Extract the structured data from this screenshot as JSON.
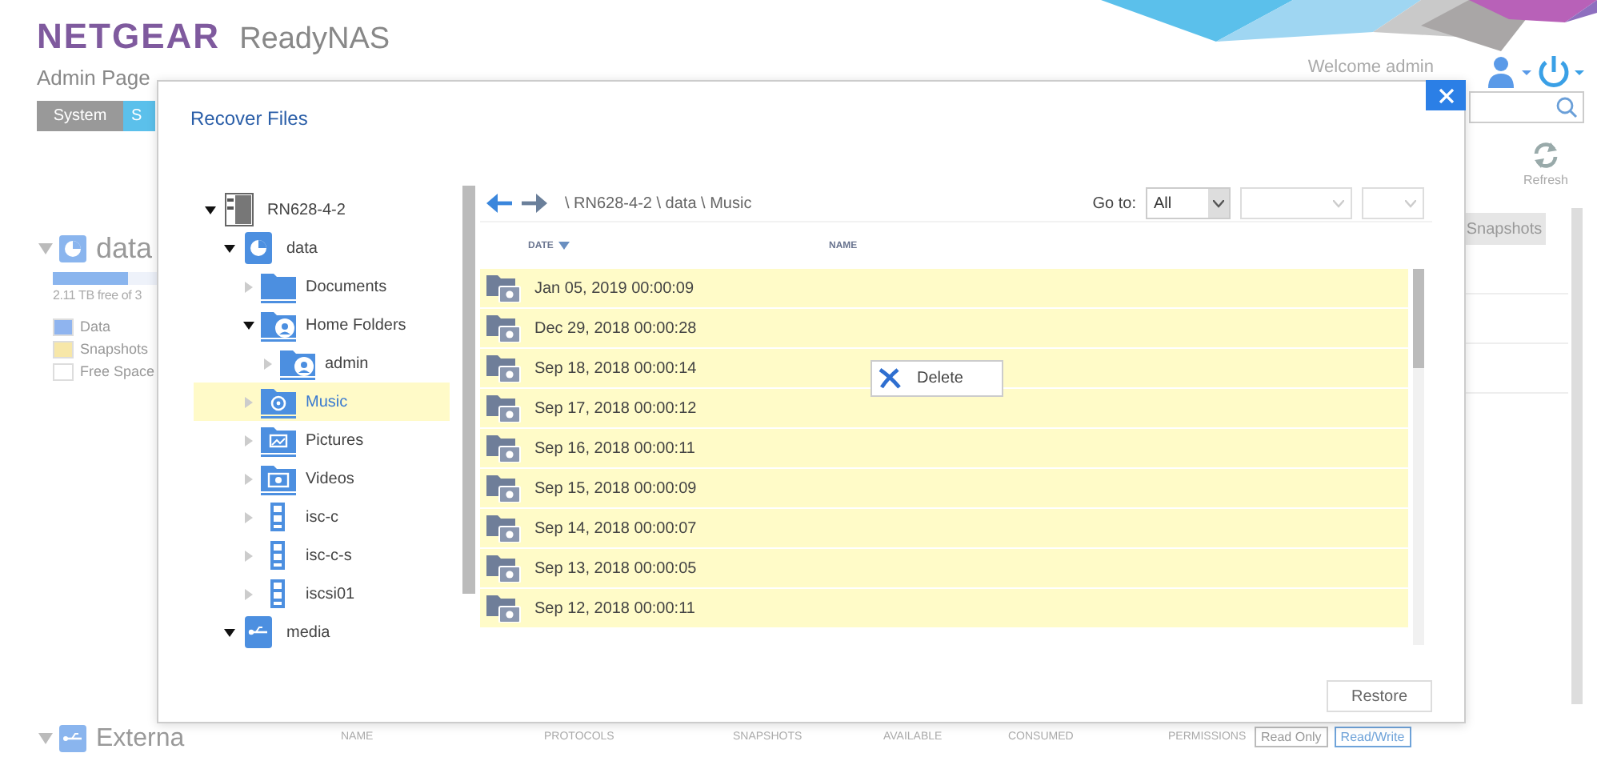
{
  "header": {
    "brand": "NETGEAR",
    "product": "ReadyNAS",
    "subtitle": "Admin Page",
    "welcome": "Welcome admin"
  },
  "nav_tabs": [
    {
      "label": "System",
      "selected": false
    },
    {
      "label": "S",
      "selected": true
    }
  ],
  "refresh_label": "Refresh",
  "volume": {
    "name": "data",
    "level": 0.73,
    "capacity": "2.11 TB free of 3",
    "legend": [
      {
        "label": "Data",
        "color": "#8fb4ef"
      },
      {
        "label": "Snapshots",
        "color": "#f7e7a8"
      },
      {
        "label": "Free Space",
        "color": "#ffffff"
      }
    ]
  },
  "snapshots_button": "Snapshots",
  "external": {
    "name": "Externa"
  },
  "table_columns": [
    "NAME",
    "PROTOCOLS",
    "SNAPSHOTS",
    "AVAILABLE",
    "CONSUMED",
    "PERMISSIONS"
  ],
  "permissions": [
    {
      "label": "Read Only",
      "selected": false
    },
    {
      "label": "Read/Write",
      "selected": true
    }
  ],
  "dialog": {
    "title": "Recover Files",
    "tree": [
      {
        "label": "RN628-4-2",
        "kind": "device",
        "expanded": true,
        "selected": false,
        "children": [
          {
            "label": "data",
            "kind": "volume",
            "expanded": true,
            "selected": false,
            "children": [
              {
                "label": "Documents",
                "kind": "folder",
                "expanded": false,
                "selected": false
              },
              {
                "label": "Home Folders",
                "kind": "home",
                "expanded": true,
                "selected": false,
                "children": [
                  {
                    "label": "admin",
                    "kind": "user",
                    "expanded": false,
                    "selected": false
                  }
                ]
              },
              {
                "label": "Music",
                "kind": "music",
                "expanded": false,
                "selected": true
              },
              {
                "label": "Pictures",
                "kind": "pictures",
                "expanded": false,
                "selected": false
              },
              {
                "label": "Videos",
                "kind": "videos",
                "expanded": false,
                "selected": false
              },
              {
                "label": "isc-c",
                "kind": "lun",
                "expanded": false,
                "selected": false
              },
              {
                "label": "isc-c-s",
                "kind": "lun",
                "expanded": false,
                "selected": false
              },
              {
                "label": "iscsi01",
                "kind": "lun",
                "expanded": false,
                "selected": false
              }
            ]
          },
          {
            "label": "media",
            "kind": "usb",
            "expanded": true,
            "selected": false
          }
        ]
      }
    ],
    "path": "\\ RN628-4-2 \\ data \\ Music",
    "goto": {
      "label": "Go to:",
      "value": "All"
    },
    "columns": [
      {
        "label": "DATE",
        "sorted": true
      },
      {
        "label": "NAME",
        "sorted": false
      }
    ],
    "rows": [
      {
        "date": "Jan 05, 2019 00:00:09"
      },
      {
        "date": "Dec 29, 2018 00:00:28"
      },
      {
        "date": "Sep 18, 2018 00:00:14"
      },
      {
        "date": "Sep 17, 2018 00:00:12"
      },
      {
        "date": "Sep 16, 2018 00:00:11"
      },
      {
        "date": "Sep 15, 2018 00:00:09"
      },
      {
        "date": "Sep 14, 2018 00:00:07"
      },
      {
        "date": "Sep 13, 2018 00:00:05"
      },
      {
        "date": "Sep 12, 2018 00:00:11"
      }
    ],
    "context_menu": {
      "label": "Delete"
    },
    "restore": "Restore"
  }
}
